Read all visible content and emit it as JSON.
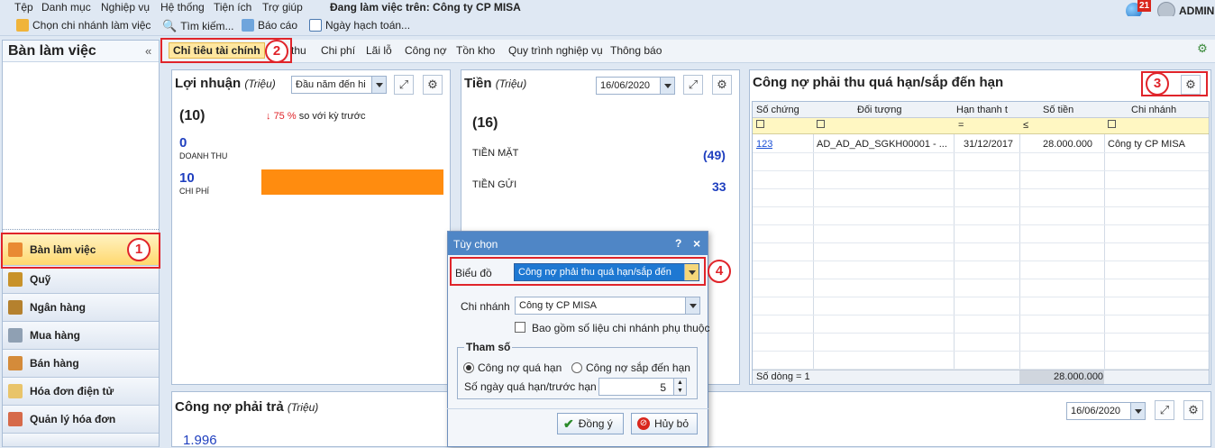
{
  "menu": [
    "Tệp",
    "Danh mục",
    "Nghiệp vụ",
    "Hệ thống",
    "Tiện ích",
    "Trợ giúp"
  ],
  "working_on": "Đang làm việc trên: Công ty CP MISA",
  "toolbar": {
    "branch": "Chọn chi nhánh làm việc",
    "search": "Tìm kiếm...",
    "report": "Báo cáo",
    "posting_date": "Ngày hạch toán..."
  },
  "user": {
    "notif_count": "21",
    "name": "ADMIN"
  },
  "left": {
    "title": "Bàn làm việc",
    "collapse": "«",
    "nav": [
      "Bàn làm việc",
      "Quỹ",
      "Ngân hàng",
      "Mua hàng",
      "Bán hàng",
      "Hóa đơn điện tử",
      "Quản lý hóa đơn"
    ]
  },
  "tabs": [
    "Chỉ tiêu tài chính",
    "thu",
    "Chi phí",
    "Lãi lỗ",
    "Công nợ",
    "Tồn kho",
    "Quy trình nghiệp vụ",
    "Thông báo"
  ],
  "badges": [
    "1",
    "2",
    "3",
    "4"
  ],
  "profit": {
    "title": "Lợi nhuận",
    "unit": "(Triệu)",
    "period": "Đầu năm đến hi",
    "value": "(10)",
    "change_arrow": "↓",
    "change_pct": "75 %",
    "change_text": "so với kỳ trước",
    "revenue_val": "0",
    "revenue_lbl": "DOANH THU",
    "expense_val": "10",
    "expense_lbl": "CHI PHÍ",
    "bar_color": "#ff8c0f",
    "expense_fill": 1.0
  },
  "cash": {
    "title": "Tiền",
    "unit": "(Triệu)",
    "date": "16/06/2020",
    "total": "(16)",
    "cash_lbl": "TIỀN MẶT",
    "cash_val": "(49)",
    "bank_lbl": "TIỀN GỬI",
    "bank_val": "33"
  },
  "receivable": {
    "title": "Công nợ phải thu quá hạn/sắp đến hạn",
    "columns": [
      "Số chứng",
      "Đối tượng",
      "Hạn thanh t",
      "Số tiền",
      "Chi nhánh"
    ],
    "filter_ops": [
      "=",
      "≤"
    ],
    "rows": [
      [
        "123",
        "AD_AD_AD_SGKH00001 - ...",
        "31/12/2017",
        "28.000.000",
        "Công ty CP MISA"
      ]
    ],
    "footer_count": "Số dòng = 1",
    "footer_total": "28.000.000"
  },
  "payable": {
    "title": "Công nợ phải trả",
    "unit": "(Triệu)",
    "date": "16/06/2020",
    "value": "1.996"
  },
  "dialog": {
    "title": "Tùy chọn",
    "help": "?",
    "close": "×",
    "chart_lbl": "Biểu đồ",
    "chart_val": "Công nợ phải thu quá hạn/sắp đến",
    "branch_lbl": "Chi nhánh",
    "branch_val": "Công ty CP MISA",
    "include_sub": "Bao gồm số liệu chi nhánh phụ thuộc",
    "params": "Tham số",
    "opt_overdue": "Công nợ quá hạn",
    "opt_due": "Công nợ sắp đến hạn",
    "days_lbl": "Số ngày quá hạn/trước hạn",
    "days_val": "5",
    "ok": "Đồng ý",
    "cancel": "Hủy bỏ"
  }
}
